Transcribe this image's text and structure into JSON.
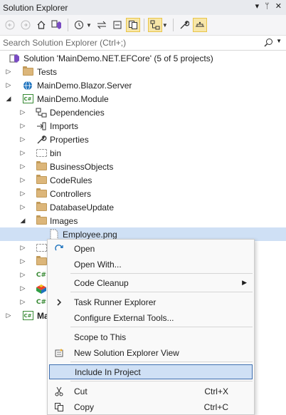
{
  "window": {
    "title": "Solution Explorer",
    "title_actions": [
      "▾",
      "ᛘ",
      "✕"
    ]
  },
  "toolbar": {
    "buttons": [
      "back",
      "forward",
      "home",
      "vs-switch",
      "history",
      "sync",
      "collapse-all",
      "show-all-files",
      "preview-selected",
      "properties",
      "pending-changes"
    ]
  },
  "search": {
    "placeholder": "Search Solution Explorer (Ctrl+;)"
  },
  "tree": {
    "solution": "Solution 'MainDemo.NET.EFCore' (5 of 5 projects)",
    "tests": "Tests",
    "blazor": "MainDemo.Blazor.Server",
    "module": "MainDemo.Module",
    "dependencies": "Dependencies",
    "imports": "Imports",
    "properties": "Properties",
    "bin": "bin",
    "business_objects": "BusinessObjects",
    "code_rules": "CodeRules",
    "controllers": "Controllers",
    "database_update": "DatabaseUpdate",
    "images": "Images",
    "employee": "Employee.png",
    "truncated_bold": "Ma"
  },
  "context_menu": {
    "open": "Open",
    "open_with": "Open With...",
    "code_cleanup": "Code Cleanup",
    "task_runner": "Task Runner Explorer",
    "configure_tools": "Configure External Tools...",
    "scope_to_this": "Scope to This",
    "new_view": "New Solution Explorer View",
    "include_in_project": "Include In Project",
    "cut": "Cut",
    "cut_shortcut": "Ctrl+X",
    "copy": "Copy",
    "copy_shortcut": "Ctrl+C",
    "submenu_arrow": "▶"
  },
  "colors": {
    "selection": "#cfe0f5",
    "highlight_border": "#3f6fb0",
    "folder": "#dcb67a",
    "csharp_green": "#388a34",
    "active_toggle": "#f7e6a8"
  }
}
